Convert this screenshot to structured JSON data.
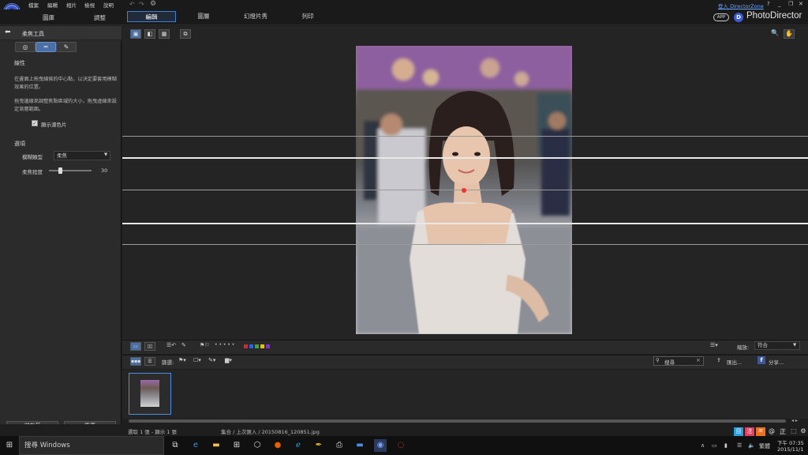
{
  "menu": {
    "items": [
      "檔案",
      "編輯",
      "相片",
      "檢視",
      "說明"
    ]
  },
  "left_tabs": [
    "圖庫",
    "調整"
  ],
  "main_tabs": [
    {
      "label": "編輯",
      "active": true
    },
    {
      "label": "圖層",
      "active": false
    },
    {
      "label": "幻燈片秀",
      "active": false
    },
    {
      "label": "列印",
      "active": false
    }
  ],
  "header": {
    "login_label": "登入 DirectorZone",
    "help_label": "?",
    "app_badge": "APP",
    "brand_name": "PhotoDirector",
    "logo_letter": "D"
  },
  "panel": {
    "title": "柔焦工具",
    "section1_title": "線性",
    "help1": "在畫面上拖曳線條的中心點，以決定要套用模糊效果的位置。",
    "help2": "拖曳邊緣來調整焦點區域的大小，拖曳虛線來設定漸層範圍。",
    "show_filter_label": "顯示濾色片",
    "section2_title": "選項",
    "blur_type_label": "模糊類型",
    "blur_type_value": "柔焦",
    "blur_amount_label": "柔焦程度",
    "blur_amount_value": "30",
    "blur_amount_fraction": 0.3,
    "save_button": "儲存至",
    "reset_button": "復原"
  },
  "toolbar": {
    "zoom_label": "縮放:",
    "zoom_value": "符合",
    "filter_label": "篩選:",
    "search_placeholder": "搜尋",
    "export_label": "匯出...",
    "share_label": "分享...",
    "dots": "• • • • •",
    "color_labels": [
      "#e02424",
      "#2a62e0",
      "#3aa83a",
      "#e0c020",
      "#8a2ae0"
    ]
  },
  "status": {
    "selection": "選取 1 張 - 顯示 1 張",
    "path": "集合 / 上次匯入 / 20150816_120851.jpg"
  },
  "taskbar": {
    "search_placeholder": "搜尋 Windows",
    "ime": "繁體",
    "time": "下午 07:35",
    "date": "2015/11/1"
  },
  "colors": {
    "accent": "#3d7fd1",
    "panel_bg": "#2b2b2b",
    "focus_point": "#e33333"
  }
}
